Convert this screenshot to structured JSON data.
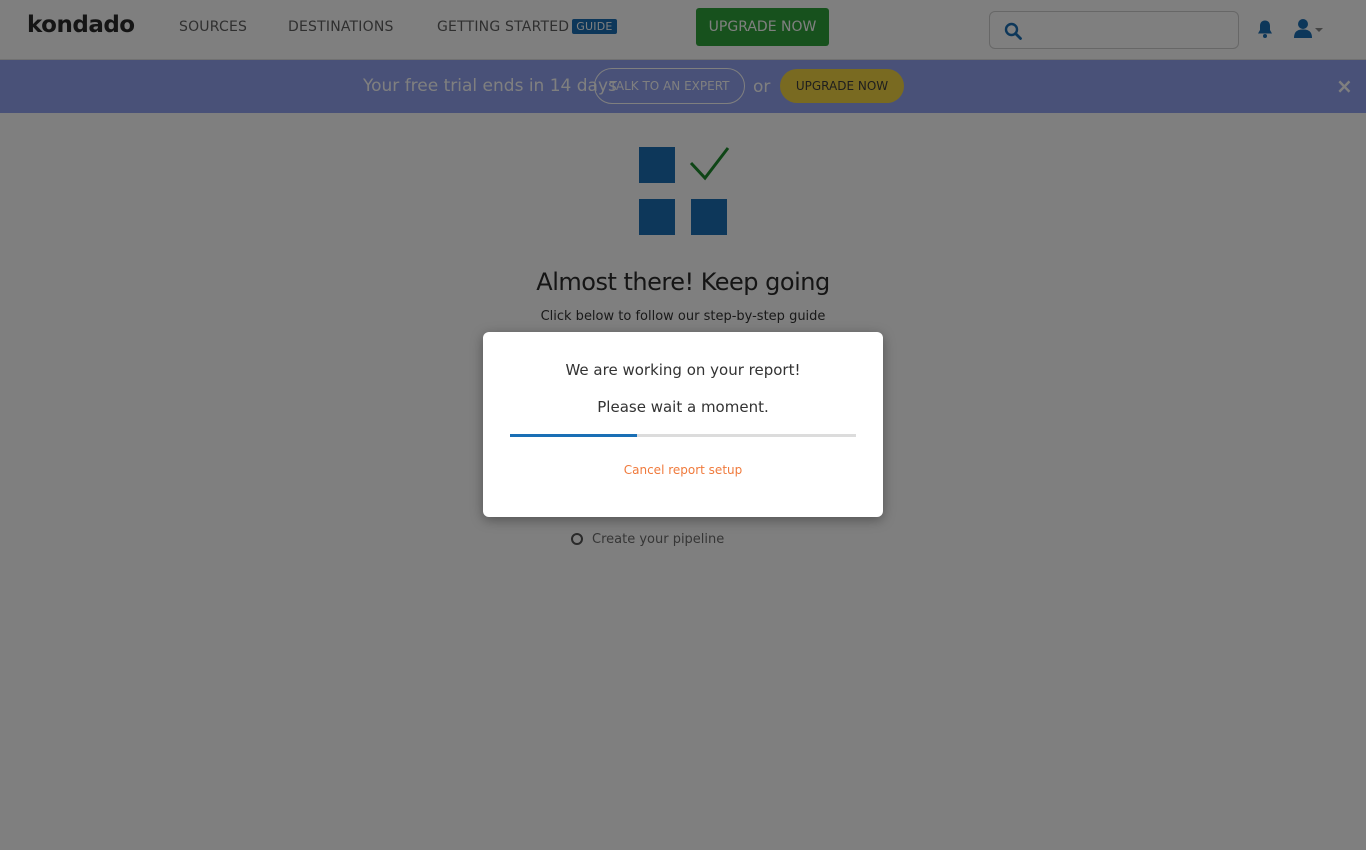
{
  "app": {
    "logo_text": "kondado"
  },
  "nav": {
    "sources": "SOURCES",
    "destinations": "DESTINATIONS",
    "getting_started": "GETTING STARTED",
    "guide_badge": "GUIDE",
    "upgrade_label": "UPGRADE NOW",
    "search_placeholder": "",
    "search_value": "",
    "icons": [
      "search-icon",
      "bell-icon",
      "user-icon",
      "caret-down-icon"
    ]
  },
  "banner": {
    "trial_text": "Your free trial ends in 14 days",
    "expert_label": "TALK TO AN EXPERT",
    "or_text": "or",
    "upgrade_label": "UPGRADE NOW",
    "close_glyph": "×"
  },
  "main": {
    "heading": "Almost there! Keep going",
    "subheading": "Click below to follow our step-by-step guide",
    "steps": [
      {
        "label": "Create your pipeline"
      }
    ]
  },
  "modal": {
    "title": "We are working on your report!",
    "subtitle": "Please wait a moment.",
    "progress_fraction": 0.367,
    "cancel_label": "Cancel report setup"
  },
  "colors": {
    "brand_blue": "#1a6fb5",
    "upgrade_green": "#2fa33b",
    "banner_purple": "#93a3f0",
    "banner_yellow": "#f3d543",
    "check_green": "#1d8a2c",
    "cancel_orange": "#f07a3c"
  }
}
